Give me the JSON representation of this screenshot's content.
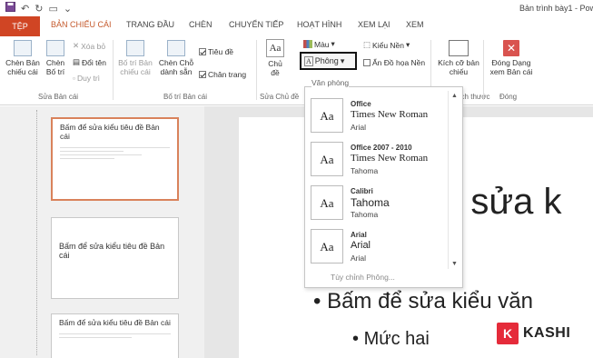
{
  "window": {
    "title": "Bản trình bày1 - Pow"
  },
  "tabs": [
    "TỆP",
    "BẢN CHIẾU CÁI",
    "TRANG ĐẦU",
    "CHÈN",
    "CHUYỂN TIẾP",
    "HOẠT HÌNH",
    "XEM LẠI",
    "XEM"
  ],
  "ribbon": {
    "insert_master": [
      "Chèn Bản",
      "chiếu cái"
    ],
    "insert_layout": [
      "Chèn",
      "Bố trí"
    ],
    "delete": "Xóa bỏ",
    "rename": "Đổi tên",
    "preserve": "Duy trì",
    "group_edit_master": "Sửa Bản cái",
    "master_layout": [
      "Bố trí Bản",
      "chiếu cái"
    ],
    "insert_placeholder": [
      "Chèn Chỗ",
      "dành sẵn"
    ],
    "title_check": "Tiêu đề",
    "footer_check": "Chân trang",
    "group_layout": "Bố trí Bản cái",
    "theme": [
      "Chủ",
      "đề"
    ],
    "group_theme": "Sửa Chủ đề",
    "colors": "Màu",
    "fonts": "Phông",
    "background_styles": "Kiểu Nền",
    "hide_bg": "Ẩn Đồ họa Nền",
    "slide_size": [
      "Kích cỡ bản",
      "chiếu"
    ],
    "close_master": [
      "Đóng Dạng",
      "xem Bản cái"
    ],
    "group_size": "Kích thước",
    "group_close": "Đóng"
  },
  "dropdown": {
    "header": "Văn phòng",
    "fonts": [
      {
        "name": "Office",
        "major": "Times New Roman",
        "minor": "Arial"
      },
      {
        "name": "Office 2007 - 2010",
        "major": "Times New Roman",
        "minor": "Tahoma"
      },
      {
        "name": "Calibri",
        "major": "Tahoma",
        "minor": "Tahoma"
      },
      {
        "name": "Arial",
        "major": "Arial",
        "minor": "Arial"
      }
    ],
    "customize": "Tùy chỉnh Phông..."
  },
  "thumbnails": {
    "t1_title": "Bấm để sửa kiểu tiêu đề Bản cái",
    "t2_title": "Bấm để sửa kiểu tiêu đề Bản cái",
    "t3_title": "Bấm để sửa kiểu tiêu đề Bản cái"
  },
  "slide": {
    "title_partial": "ể sửa k",
    "bullet1": "Bấm để sửa kiểu văn",
    "bullet2": "Mức hai"
  },
  "watermark": {
    "brand": "KASHI",
    "letter": "K"
  },
  "colors": {
    "file_tab": "#d04524",
    "accent": "#c55a2d",
    "logo": "#e52b3a"
  }
}
